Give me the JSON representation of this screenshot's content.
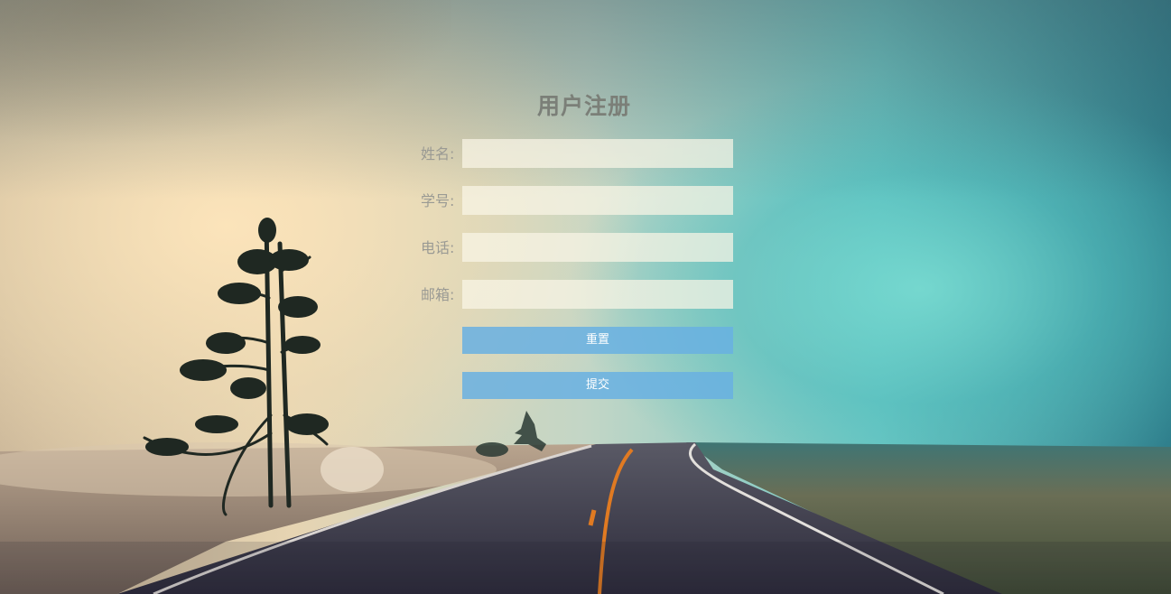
{
  "form": {
    "title": "用户注册",
    "fields": [
      {
        "label": "姓名:",
        "value": "",
        "placeholder": ""
      },
      {
        "label": "学号:",
        "value": "",
        "placeholder": ""
      },
      {
        "label": "电话:",
        "value": "",
        "placeholder": ""
      },
      {
        "label": "邮箱:",
        "value": "",
        "placeholder": ""
      }
    ],
    "reset_label": "重置",
    "submit_label": "提交"
  },
  "colors": {
    "button": "#69b0e2",
    "title": "#7b7f78",
    "input_bg": "#faf5e6"
  }
}
